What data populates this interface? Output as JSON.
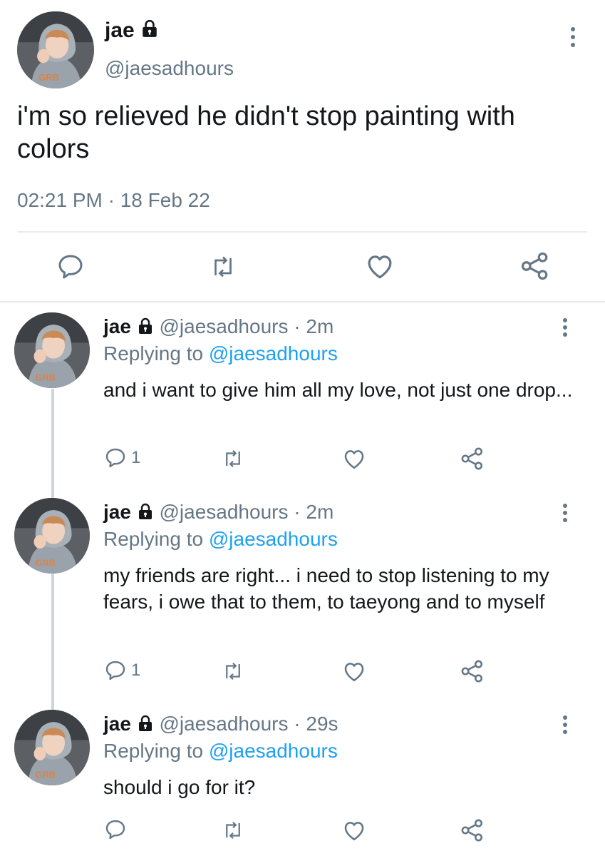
{
  "main_tweet": {
    "name": "jae",
    "handle": "@jaesadhours",
    "text": "i'm so relieved he didn't stop painting with colors",
    "timestamp": "02:21 PM · 18 Feb 22"
  },
  "replies": [
    {
      "name": "jae",
      "handle": "@jaesadhours",
      "time": "· 2m",
      "replying_prefix": "Replying to",
      "replying_to": "@jaesadhours",
      "text": "and i want to give him all my love, not just one drop...",
      "reply_count": "1"
    },
    {
      "name": "jae",
      "handle": "@jaesadhours",
      "time": "· 2m",
      "replying_prefix": "Replying to",
      "replying_to": "@jaesadhours",
      "text": "my friends are right... i need to stop listening to my fears, i owe that to them, to taeyong and to myself",
      "reply_count": "1"
    },
    {
      "name": "jae",
      "handle": "@jaesadhours",
      "time": "· 29s",
      "replying_prefix": "Replying to",
      "replying_to": "@jaesadhours",
      "text": "should i go for it?",
      "reply_count": ""
    }
  ],
  "icons": {
    "reply": "speech-bubble-icon",
    "retweet": "retweet-icon",
    "like": "heart-icon",
    "share": "share-icon",
    "more": "vertical-dots-icon",
    "lock": "lock-icon"
  },
  "colors": {
    "text": "#14171a",
    "secondary": "#657786",
    "link": "#1da1f2",
    "divider": "#e6ecf0"
  }
}
